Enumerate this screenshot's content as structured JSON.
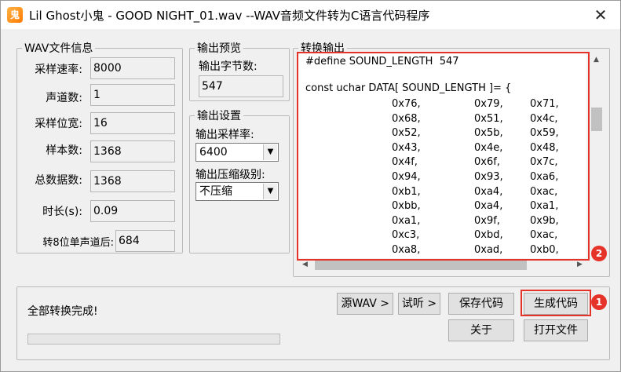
{
  "window": {
    "title": "Lil Ghost小鬼 - GOOD NIGHT_01.wav    --WAV音频文件转为C语言代码程序",
    "icon_label": "鬼",
    "close_glyph": "✕"
  },
  "wav_info": {
    "legend": "WAV文件信息",
    "rows": [
      {
        "label": "采样速率:",
        "value": "8000"
      },
      {
        "label": "声道数:",
        "value": "1"
      },
      {
        "label": "采样位宽:",
        "value": "16"
      },
      {
        "label": "样本数:",
        "value": "1368"
      },
      {
        "label": "总数据数:",
        "value": "1368"
      },
      {
        "label": "时长(s):",
        "value": "0.09"
      },
      {
        "label": "转8位单声道后:",
        "value": "684"
      }
    ]
  },
  "preview": {
    "legend": "输出预览",
    "label": "输出字节数:",
    "value": "547"
  },
  "settings": {
    "legend": "输出设置",
    "rate_label": "输出采样率:",
    "rate_value": "6400",
    "compress_label": "输出压缩级别:",
    "compress_value": "不压缩"
  },
  "output": {
    "legend": "转换输出",
    "define_line": "#define SOUND_LENGTH  547",
    "decl_line": "const uchar DATA[ SOUND_LENGTH ]= {",
    "rows": [
      [
        "0x76,",
        "0x79,",
        "0x71,"
      ],
      [
        "0x68,",
        "0x51,",
        "0x4c,"
      ],
      [
        "0x52,",
        "0x5b,",
        "0x59,"
      ],
      [
        "0x43,",
        "0x4e,",
        "0x48,"
      ],
      [
        "0x4f,",
        "0x6f,",
        "0x7c,"
      ],
      [
        "0x94,",
        "0x93,",
        "0xa6,"
      ],
      [
        "0xb1,",
        "0xa4,",
        "0xac,"
      ],
      [
        "0xbb,",
        "0xa4,",
        "0xa1,"
      ],
      [
        "0xa1,",
        "0x9f,",
        "0x9b,"
      ],
      [
        "0xc3,",
        "0xbd,",
        "0xac,"
      ],
      [
        "0xa8,",
        "0xad,",
        "0xb0,"
      ]
    ]
  },
  "buttons": {
    "source_wav": "源WAV >",
    "try_listen": "试听 >",
    "save_code": "保存代码",
    "generate_code": "生成代码",
    "about": "关于",
    "open_file": "打开文件"
  },
  "status": {
    "text": "全部转换完成!",
    "progress": 0
  },
  "annotations": {
    "badge_1": "1",
    "badge_2": "2",
    "highlight_color": "#e5332a"
  }
}
